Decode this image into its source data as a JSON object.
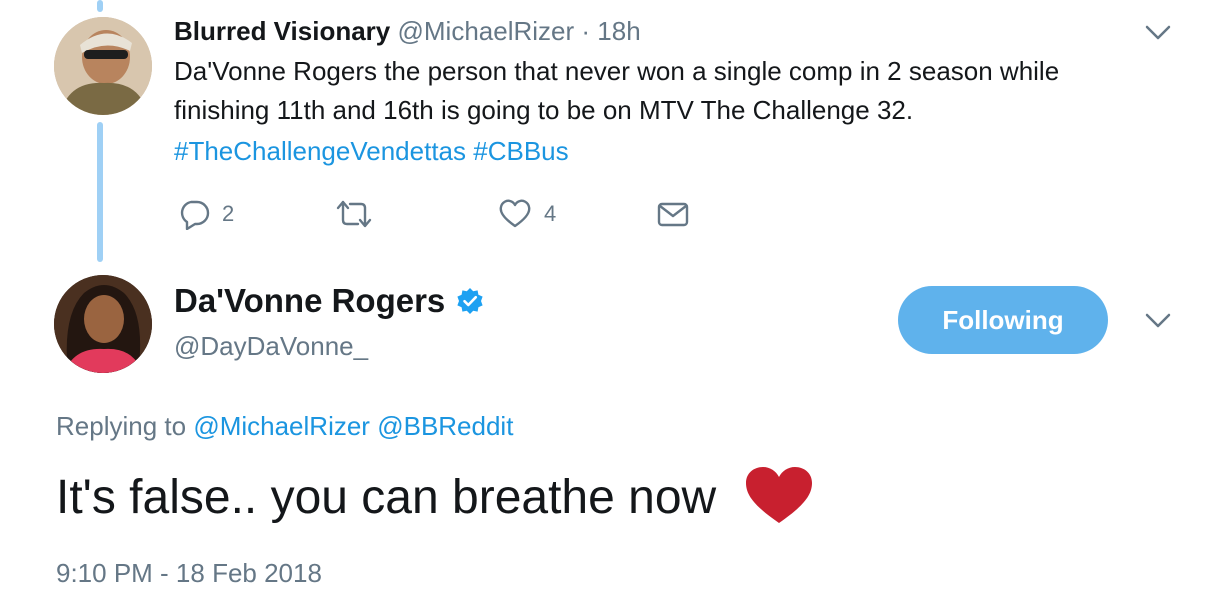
{
  "parent_tweet": {
    "author_name": "Blurred Visionary",
    "author_handle": "@MichaelRizer",
    "separator": "·",
    "time_ago": "18h",
    "text_line1": "Da'Vonne Rogers the person that never won a single comp in 2 season while",
    "text_line2": "finishing 11th  and 16th is going to be on MTV The Challenge 32.",
    "hashtag1": "#TheChallengeVendettas",
    "hashtag2": "#CBBus",
    "reply_count": "2",
    "like_count": "4"
  },
  "main_tweet": {
    "author_name": "Da'Vonne Rogers",
    "author_handle": "@DayDaVonne_",
    "follow_label": "Following",
    "replying_prefix": "Replying to",
    "reply_mention1": "@MichaelRizer",
    "reply_mention2": "@BBReddit",
    "text": "It's false.. you can breathe now",
    "emoji": "heart-icon",
    "timestamp": "9:10 PM - 18 Feb 2018"
  },
  "colors": {
    "link_blue": "#1b95e0",
    "follow_button": "#5fb2ec",
    "thread_line": "#9fd0f5",
    "heart_red": "#c8202f"
  }
}
